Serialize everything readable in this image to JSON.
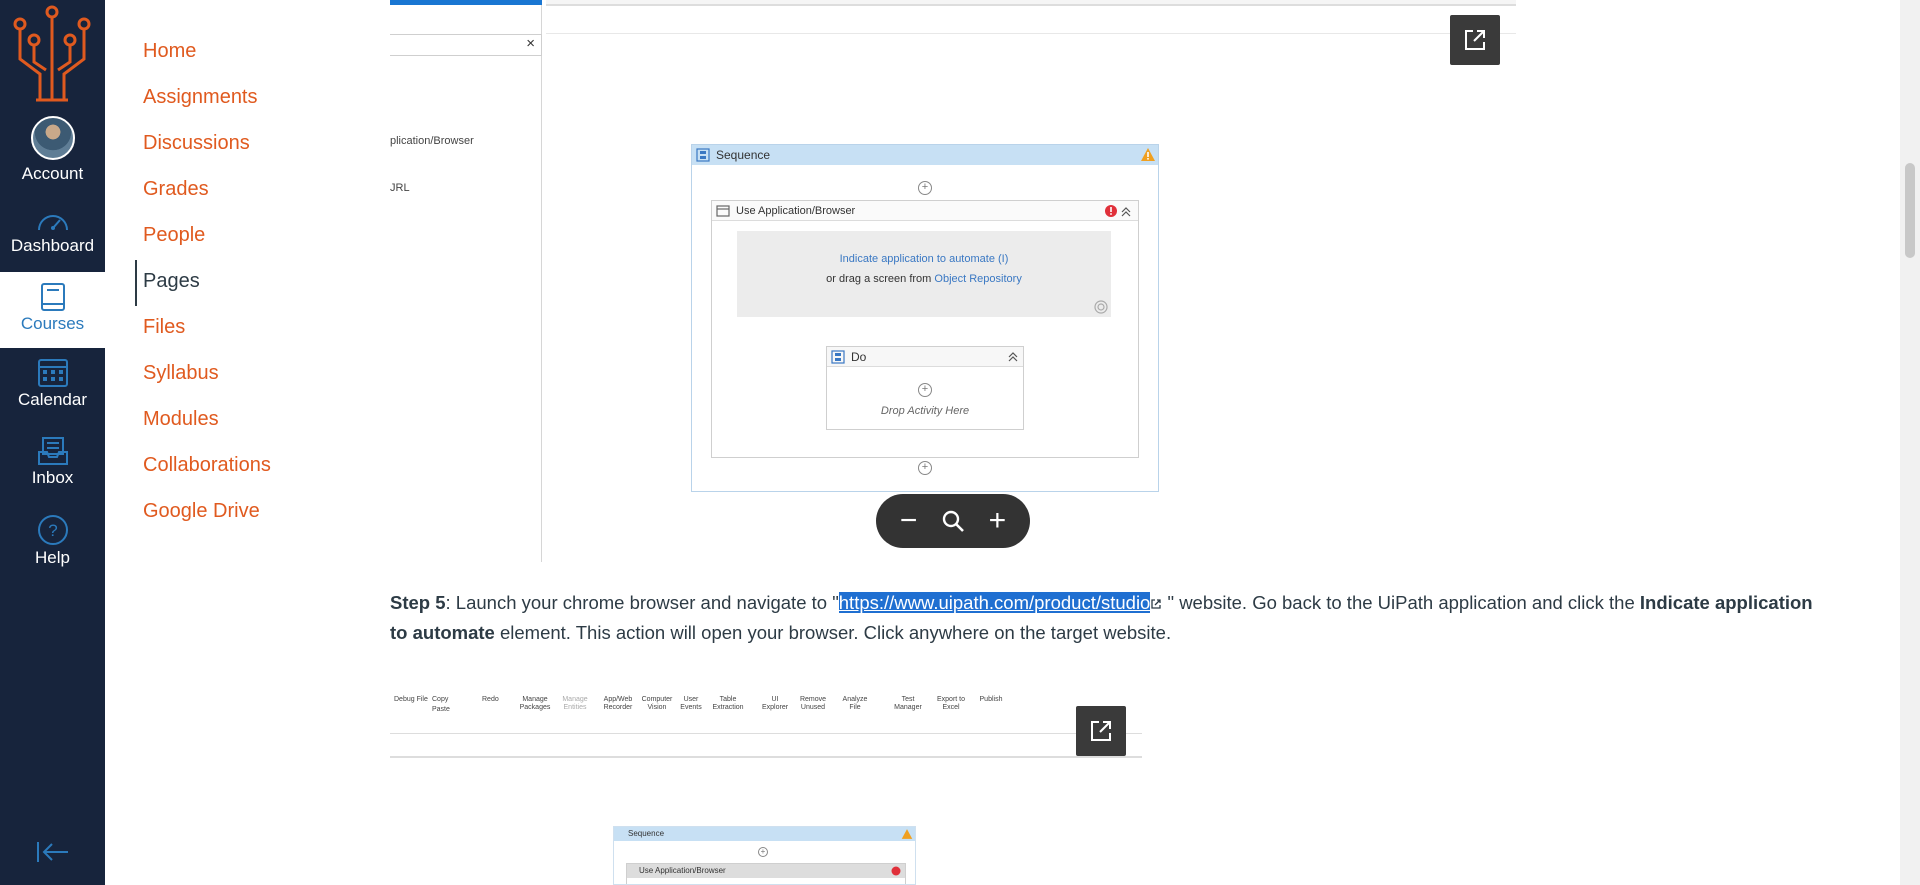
{
  "global_nav": {
    "account": "Account",
    "dashboard": "Dashboard",
    "courses": "Courses",
    "calendar": "Calendar",
    "inbox": "Inbox",
    "help": "Help"
  },
  "course_nav": {
    "items": [
      "Home",
      "Assignments",
      "Discussions",
      "Grades",
      "People",
      "Pages",
      "Files",
      "Syllabus",
      "Modules",
      "Collaborations",
      "Google Drive"
    ],
    "active": "Pages"
  },
  "screenshot1": {
    "left_text_1": "plication/Browser",
    "left_text_2": "JRL",
    "close_glyph": "×",
    "sequence_label": "Sequence",
    "use_app_label": "Use Application/Browser",
    "indicate_label": "Indicate application to automate (I)",
    "drag_prefix": "or drag a screen from",
    "object_repository": "Object Repository",
    "do_label": "Do",
    "drop_label": "Drop Activity Here"
  },
  "zoom_controls": {
    "minus": "−",
    "plus": "+"
  },
  "step5": {
    "label": "Step 5",
    "text_before_link": ": Launch your chrome browser and navigate to \"",
    "link": "https://www.uipath.com/product/studio",
    "text_after_link": " \" website. Go back to the UiPath application and click the ",
    "bold_part": "Indicate application to automate",
    "text_end": " element. This action will open your browser. Click anywhere on the target website."
  },
  "screenshot2": {
    "ribbon": [
      "Debug File",
      "Copy",
      "Paste",
      "Redo",
      "Manage Packages",
      "Manage Entities",
      "App/Web Recorder",
      "Computer Vision",
      "User Events",
      "Table Extraction",
      "UI Explorer",
      "Remove Unused",
      "Analyze File",
      "Test Manager",
      "Export to Excel",
      "Publish"
    ]
  },
  "screenshot3": {
    "sequence_label": "Sequence",
    "use_app_label": "Use Application/Browser"
  },
  "colors": {
    "nav_bg": "#17243c",
    "link_orange": "#e05a1f",
    "active_blue": "#2b7abc"
  }
}
